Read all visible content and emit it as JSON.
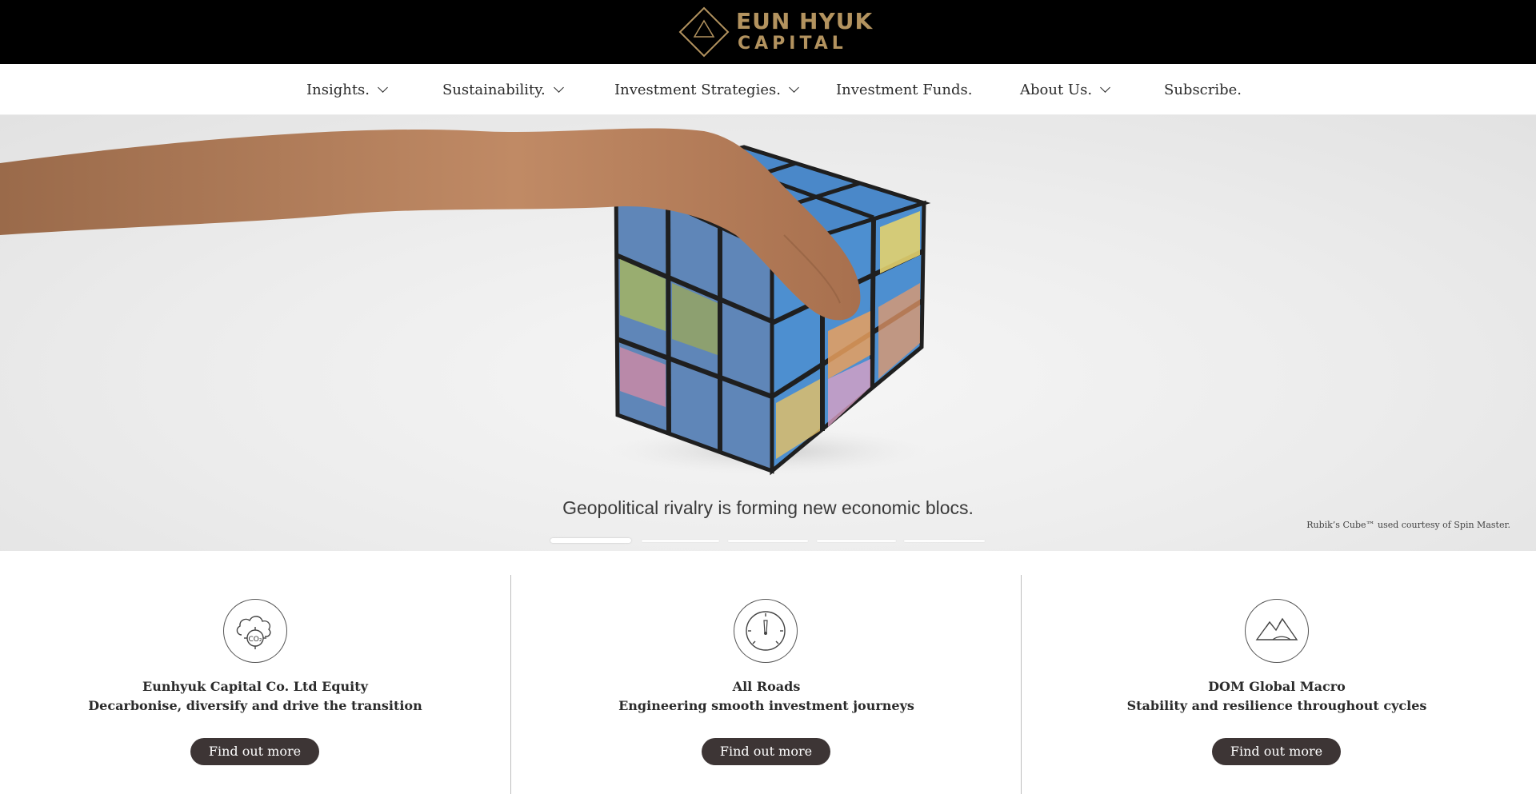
{
  "brand": {
    "line1": "EUN HYUK",
    "line2": "CAPITAL",
    "logo_icon": "diamond-triangle-logo",
    "color": "#b3935f"
  },
  "nav": {
    "items": [
      {
        "label": "Insights.",
        "has_dropdown": true
      },
      {
        "label": "Sustainability.",
        "has_dropdown": true
      },
      {
        "label": "Investment Strategies.",
        "has_dropdown": true
      },
      {
        "label": "Investment Funds.",
        "has_dropdown": false
      },
      {
        "label": "About Us.",
        "has_dropdown": true
      },
      {
        "label": "Subscribe.",
        "has_dropdown": false
      }
    ]
  },
  "hero": {
    "caption": "Geopolitical rivalry is forming new economic blocs.",
    "credit": "Rubik’s Cube™ used courtesy of Spin Master.",
    "slides_count": 5,
    "active_slide": 1
  },
  "cards": [
    {
      "icon": "co2-cloud-icon",
      "title": "Eunhyuk Capital Co. Ltd Equity",
      "subtitle": "Decarbonise, diversify and drive the transition",
      "button": "Find out more"
    },
    {
      "icon": "speedometer-icon",
      "title": "All Roads",
      "subtitle": "Engineering smooth investment journeys",
      "button": "Find out more"
    },
    {
      "icon": "mountains-icon",
      "title": "DOM Global Macro",
      "subtitle": "Stability and resilience throughout cycles",
      "button": "Find out more"
    }
  ],
  "colors": {
    "header_bg": "#000000",
    "button_bg": "#3d3535",
    "text": "#2b2b2b"
  }
}
